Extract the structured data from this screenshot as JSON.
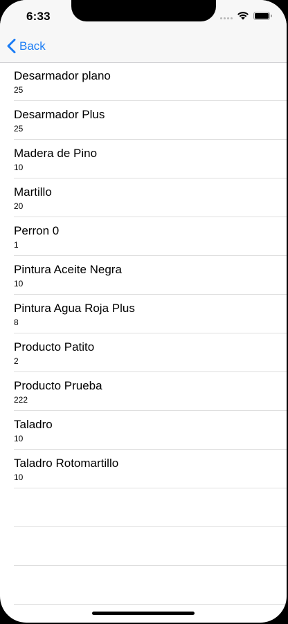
{
  "status_bar": {
    "time": "6:33"
  },
  "nav": {
    "back_label": "Back",
    "accent_color": "#1a7cf5"
  },
  "products": [
    {
      "name": "Desarmador plano",
      "qty": "25"
    },
    {
      "name": "Desarmador Plus",
      "qty": "25"
    },
    {
      "name": "Madera de Pino",
      "qty": "10"
    },
    {
      "name": "Martillo",
      "qty": "20"
    },
    {
      "name": "Perron 0",
      "qty": "1"
    },
    {
      "name": "Pintura Aceite Negra",
      "qty": "10"
    },
    {
      "name": "Pintura Agua Roja Plus",
      "qty": "8"
    },
    {
      "name": "Producto Patito",
      "qty": "2"
    },
    {
      "name": "Producto Prueba",
      "qty": "222"
    },
    {
      "name": "Taladro",
      "qty": "10"
    },
    {
      "name": "Taladro Rotomartillo",
      "qty": "10"
    }
  ]
}
